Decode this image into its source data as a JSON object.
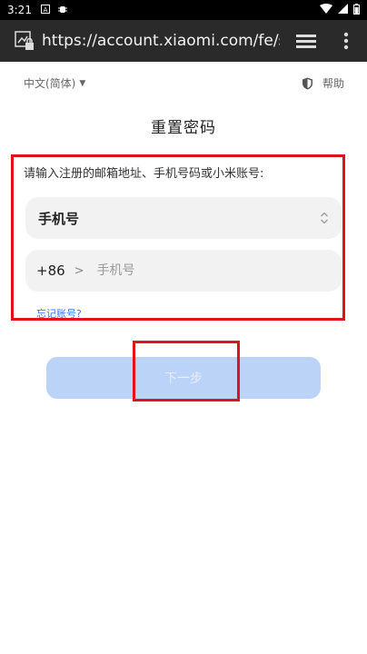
{
  "status_bar": {
    "time": "3:21",
    "icons": [
      "notification-a-icon",
      "bug-icon",
      "wifi-icon",
      "signal-icon",
      "battery-icon"
    ]
  },
  "browser": {
    "url": "https://account.xiaomi.com/fe/serv"
  },
  "page": {
    "language": "中文(简体)",
    "help": "帮助",
    "title": "重置密码",
    "hint": "请输入注册的邮箱地址、手机号码或小米账号:",
    "account_type": "手机号",
    "country_code": "+86",
    "phone_placeholder": "手机号",
    "forgot_link": "忘记账号?",
    "next_button": "下一步"
  },
  "colors": {
    "accent": "#3478f6",
    "button_disabled": "#bcd3f8",
    "highlight": "#e0131c"
  }
}
